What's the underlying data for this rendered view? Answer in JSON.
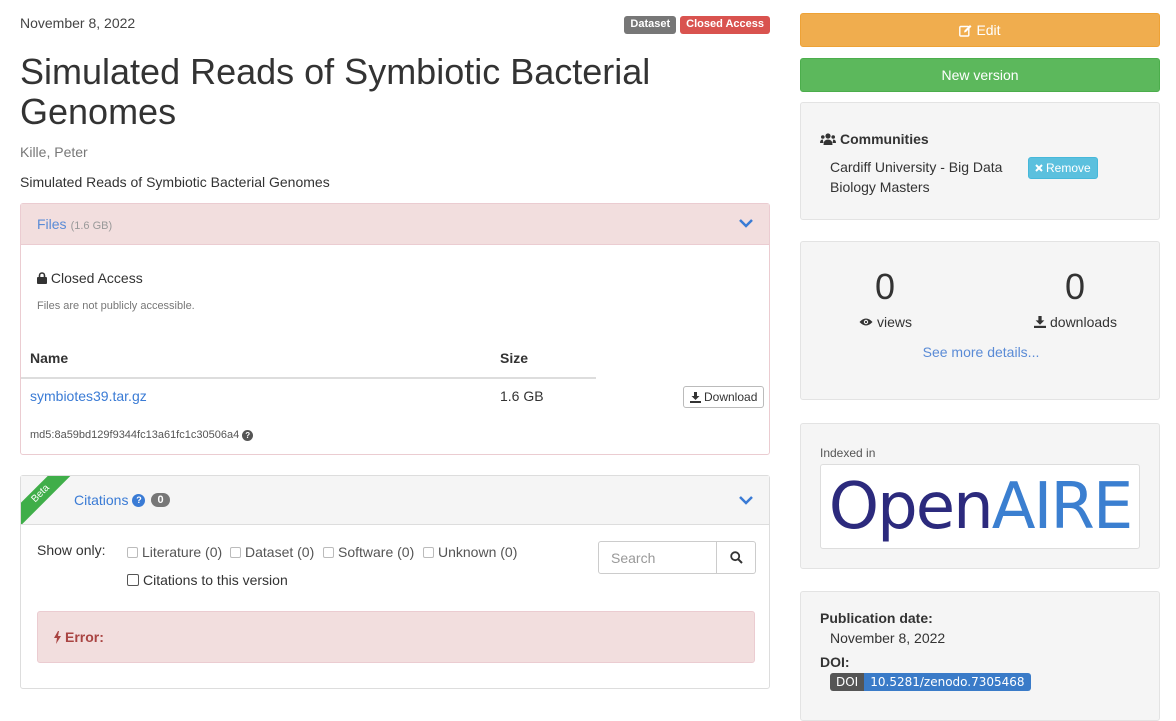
{
  "record": {
    "publication_date": "November 8, 2022",
    "labels": {
      "type": "Dataset",
      "access": "Closed Access"
    },
    "title": "Simulated Reads of Symbiotic Bacterial Genomes",
    "creator": "Kille, Peter",
    "description": "Simulated Reads of Symbiotic Bacterial Genomes"
  },
  "files": {
    "title": "Files",
    "total_size": "(1.6 GB)",
    "closed_title": "Closed Access",
    "closed_note": "Files are not publicly accessible.",
    "col_name": "Name",
    "col_size": "Size",
    "file_name": "symbiotes39.tar.gz",
    "file_size": "1.6 GB",
    "download_label": "Download",
    "md5": "md5:8a59bd129f9344fc13a61fc1c30506a4"
  },
  "citations": {
    "beta": "Beta",
    "title": "Citations",
    "count": "0",
    "show_only": "Show only:",
    "filters": [
      "Literature (0)",
      "Dataset (0)",
      "Software (0)",
      "Unknown (0)"
    ],
    "this_version": "Citations to this version",
    "search_placeholder": "Search",
    "error_label": "Error:"
  },
  "sidebar": {
    "edit_label": "Edit",
    "new_version_label": "New version",
    "communities_title": "Communities",
    "community_name": "Cardiff University - Big Data Biology Masters",
    "remove_label": "Remove",
    "views_count": "0",
    "views_label": "views",
    "downloads_count": "0",
    "downloads_label": "downloads",
    "more_details": "See more details...",
    "indexed_in": "Indexed in",
    "logo": {
      "part1": "Open",
      "part2": "AIRE"
    },
    "publication_date_label": "Publication date:",
    "publication_date": "November 8, 2022",
    "doi_label": "DOI:",
    "doi_badge_left": "DOI",
    "doi_value": "10.5281/zenodo.7305468"
  }
}
